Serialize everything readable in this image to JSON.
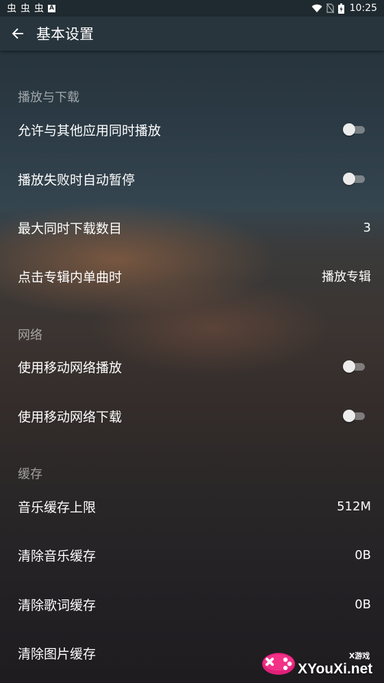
{
  "status_bar": {
    "notification_icons": [
      "虫",
      "虫",
      "虫"
    ],
    "a_badge": "A",
    "time": "10:25"
  },
  "app_bar": {
    "title": "基本设置"
  },
  "sections": [
    {
      "header": "播放与下载",
      "rows": [
        {
          "label": "允许与其他应用同时播放",
          "switch_on": false
        },
        {
          "label": "播放失败时自动暂停",
          "switch_on": false
        },
        {
          "label": "最大同时下载数目",
          "value": "3"
        },
        {
          "label": "点击专辑内单曲时",
          "value": "播放专辑"
        }
      ]
    },
    {
      "header": "网络",
      "rows": [
        {
          "label": "使用移动网络播放",
          "switch_on": false
        },
        {
          "label": "使用移动网络下载",
          "switch_on": false
        }
      ]
    },
    {
      "header": "缓存",
      "rows": [
        {
          "label": "音乐缓存上限",
          "value": "512M"
        },
        {
          "label": "清除音乐缓存",
          "value": "0B"
        },
        {
          "label": "清除歌词缓存",
          "value": "0B"
        },
        {
          "label": "清除图片缓存"
        }
      ]
    }
  ],
  "watermark": {
    "cn": "X游戏",
    "en": "XYouXi.net"
  }
}
